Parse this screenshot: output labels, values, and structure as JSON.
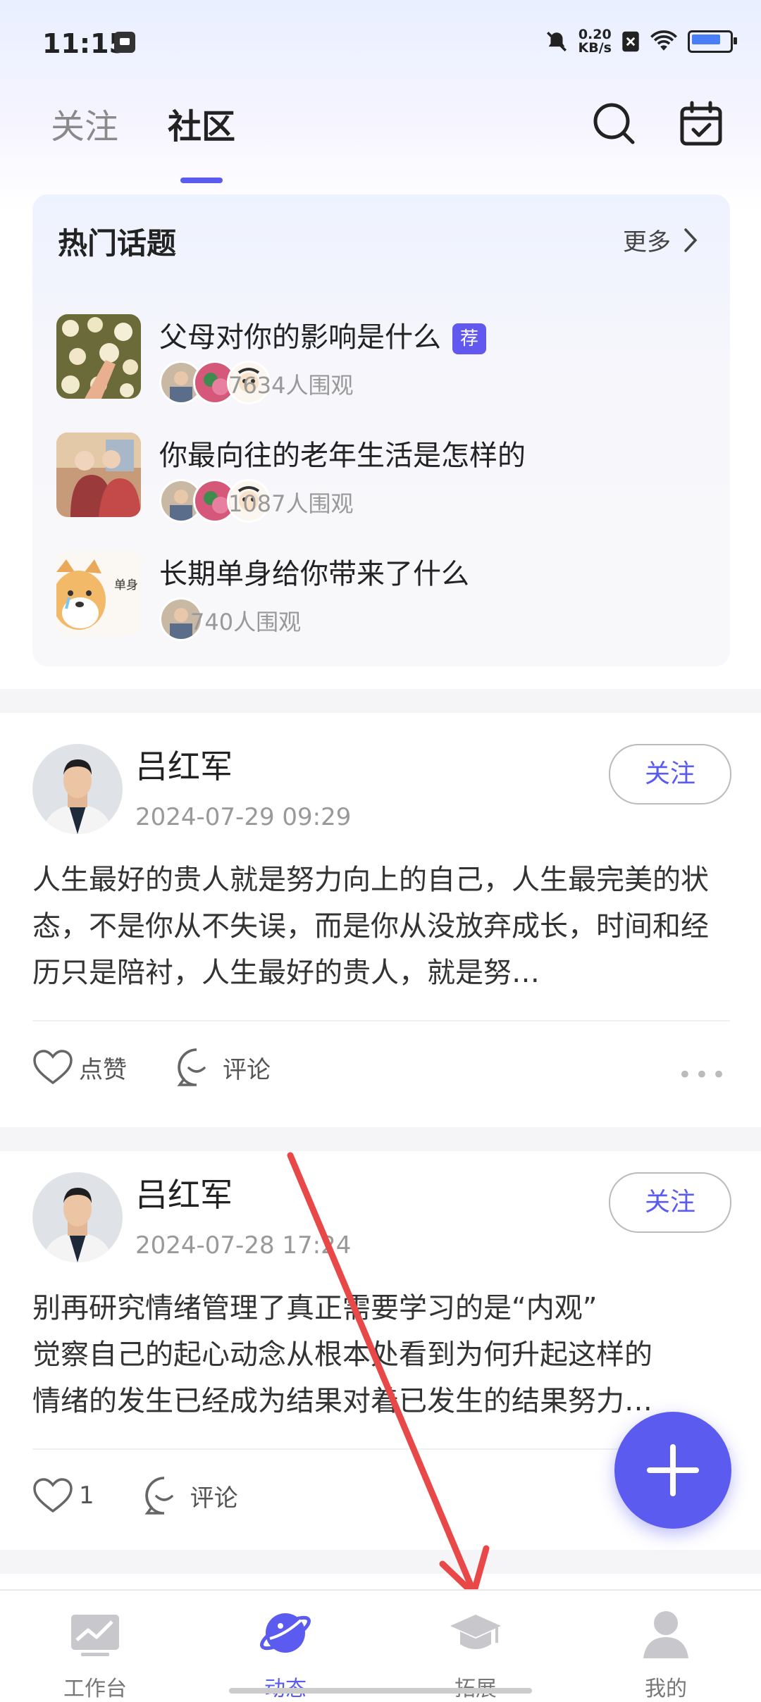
{
  "status_bar": {
    "time": "11:15",
    "net_speed": "0.20",
    "net_unit": "KB/s"
  },
  "header": {
    "tabs": [
      {
        "label": "关注"
      },
      {
        "label": "社区"
      }
    ]
  },
  "hot_topics": {
    "title": "热门话题",
    "more_label": "更多",
    "items": [
      {
        "title": "父母对你的影响是什么",
        "badge": "荐",
        "views": "7634人围观"
      },
      {
        "title": "你最向往的老年生活是怎样的",
        "views": "1087人围观"
      },
      {
        "title": "长期单身给你带来了什么",
        "views": "740人围观",
        "thumb_text": "单身"
      }
    ]
  },
  "posts": [
    {
      "author": "吕红军",
      "time": "2024-07-29 09:29",
      "follow_label": "关注",
      "content": "人生最好的贵人就是努力向上的自己，人生最完美的状态，不是你从不失误，而是你从没放弃成长，时间和经历只是陪衬，人生最好的贵人，就是努…",
      "like_label": "点赞",
      "comment_label": "评论"
    },
    {
      "author": "吕红军",
      "time": "2024-07-28 17:24",
      "follow_label": "关注",
      "content_lines": [
        "别再研究情绪管理了真正需要学习的是“内观”",
        "觉察自己的起心动念从根本处看到为何升起这样的",
        "情绪的发生已经成为结果对着已发生的结果努力…"
      ],
      "like_count": "1",
      "comment_label": "评论"
    }
  ],
  "bottom_nav": [
    {
      "label": "工作台",
      "icon": "chart-icon"
    },
    {
      "label": "动态",
      "icon": "planet-icon",
      "active": true
    },
    {
      "label": "拓展",
      "icon": "graduation-cap-icon"
    },
    {
      "label": "我的",
      "icon": "person-icon"
    }
  ],
  "colors": {
    "accent": "#5b5bf0",
    "annotation_arrow": "#e94848"
  }
}
